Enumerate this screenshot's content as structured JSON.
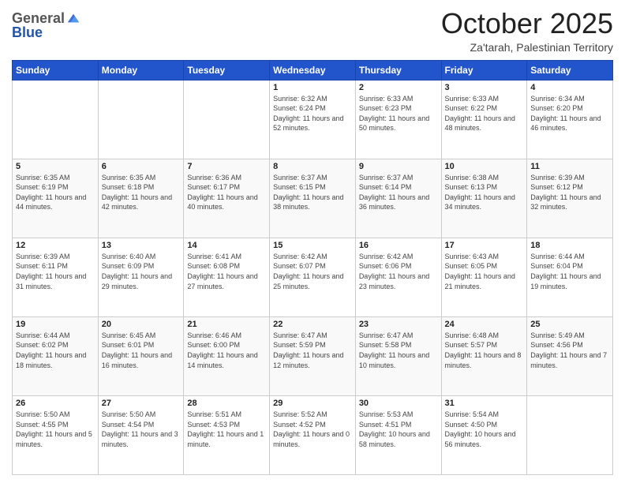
{
  "header": {
    "logo_general": "General",
    "logo_blue": "Blue",
    "month": "October 2025",
    "location": "Za'tarah, Palestinian Territory"
  },
  "days_of_week": [
    "Sunday",
    "Monday",
    "Tuesday",
    "Wednesday",
    "Thursday",
    "Friday",
    "Saturday"
  ],
  "weeks": [
    [
      {
        "day": "",
        "info": ""
      },
      {
        "day": "",
        "info": ""
      },
      {
        "day": "",
        "info": ""
      },
      {
        "day": "1",
        "info": "Sunrise: 6:32 AM\nSunset: 6:24 PM\nDaylight: 11 hours and 52 minutes."
      },
      {
        "day": "2",
        "info": "Sunrise: 6:33 AM\nSunset: 6:23 PM\nDaylight: 11 hours and 50 minutes."
      },
      {
        "day": "3",
        "info": "Sunrise: 6:33 AM\nSunset: 6:22 PM\nDaylight: 11 hours and 48 minutes."
      },
      {
        "day": "4",
        "info": "Sunrise: 6:34 AM\nSunset: 6:20 PM\nDaylight: 11 hours and 46 minutes."
      }
    ],
    [
      {
        "day": "5",
        "info": "Sunrise: 6:35 AM\nSunset: 6:19 PM\nDaylight: 11 hours and 44 minutes."
      },
      {
        "day": "6",
        "info": "Sunrise: 6:35 AM\nSunset: 6:18 PM\nDaylight: 11 hours and 42 minutes."
      },
      {
        "day": "7",
        "info": "Sunrise: 6:36 AM\nSunset: 6:17 PM\nDaylight: 11 hours and 40 minutes."
      },
      {
        "day": "8",
        "info": "Sunrise: 6:37 AM\nSunset: 6:15 PM\nDaylight: 11 hours and 38 minutes."
      },
      {
        "day": "9",
        "info": "Sunrise: 6:37 AM\nSunset: 6:14 PM\nDaylight: 11 hours and 36 minutes."
      },
      {
        "day": "10",
        "info": "Sunrise: 6:38 AM\nSunset: 6:13 PM\nDaylight: 11 hours and 34 minutes."
      },
      {
        "day": "11",
        "info": "Sunrise: 6:39 AM\nSunset: 6:12 PM\nDaylight: 11 hours and 32 minutes."
      }
    ],
    [
      {
        "day": "12",
        "info": "Sunrise: 6:39 AM\nSunset: 6:11 PM\nDaylight: 11 hours and 31 minutes."
      },
      {
        "day": "13",
        "info": "Sunrise: 6:40 AM\nSunset: 6:09 PM\nDaylight: 11 hours and 29 minutes."
      },
      {
        "day": "14",
        "info": "Sunrise: 6:41 AM\nSunset: 6:08 PM\nDaylight: 11 hours and 27 minutes."
      },
      {
        "day": "15",
        "info": "Sunrise: 6:42 AM\nSunset: 6:07 PM\nDaylight: 11 hours and 25 minutes."
      },
      {
        "day": "16",
        "info": "Sunrise: 6:42 AM\nSunset: 6:06 PM\nDaylight: 11 hours and 23 minutes."
      },
      {
        "day": "17",
        "info": "Sunrise: 6:43 AM\nSunset: 6:05 PM\nDaylight: 11 hours and 21 minutes."
      },
      {
        "day": "18",
        "info": "Sunrise: 6:44 AM\nSunset: 6:04 PM\nDaylight: 11 hours and 19 minutes."
      }
    ],
    [
      {
        "day": "19",
        "info": "Sunrise: 6:44 AM\nSunset: 6:02 PM\nDaylight: 11 hours and 18 minutes."
      },
      {
        "day": "20",
        "info": "Sunrise: 6:45 AM\nSunset: 6:01 PM\nDaylight: 11 hours and 16 minutes."
      },
      {
        "day": "21",
        "info": "Sunrise: 6:46 AM\nSunset: 6:00 PM\nDaylight: 11 hours and 14 minutes."
      },
      {
        "day": "22",
        "info": "Sunrise: 6:47 AM\nSunset: 5:59 PM\nDaylight: 11 hours and 12 minutes."
      },
      {
        "day": "23",
        "info": "Sunrise: 6:47 AM\nSunset: 5:58 PM\nDaylight: 11 hours and 10 minutes."
      },
      {
        "day": "24",
        "info": "Sunrise: 6:48 AM\nSunset: 5:57 PM\nDaylight: 11 hours and 8 minutes."
      },
      {
        "day": "25",
        "info": "Sunrise: 5:49 AM\nSunset: 4:56 PM\nDaylight: 11 hours and 7 minutes."
      }
    ],
    [
      {
        "day": "26",
        "info": "Sunrise: 5:50 AM\nSunset: 4:55 PM\nDaylight: 11 hours and 5 minutes."
      },
      {
        "day": "27",
        "info": "Sunrise: 5:50 AM\nSunset: 4:54 PM\nDaylight: 11 hours and 3 minutes."
      },
      {
        "day": "28",
        "info": "Sunrise: 5:51 AM\nSunset: 4:53 PM\nDaylight: 11 hours and 1 minute."
      },
      {
        "day": "29",
        "info": "Sunrise: 5:52 AM\nSunset: 4:52 PM\nDaylight: 11 hours and 0 minutes."
      },
      {
        "day": "30",
        "info": "Sunrise: 5:53 AM\nSunset: 4:51 PM\nDaylight: 10 hours and 58 minutes."
      },
      {
        "day": "31",
        "info": "Sunrise: 5:54 AM\nSunset: 4:50 PM\nDaylight: 10 hours and 56 minutes."
      },
      {
        "day": "",
        "info": ""
      }
    ]
  ]
}
